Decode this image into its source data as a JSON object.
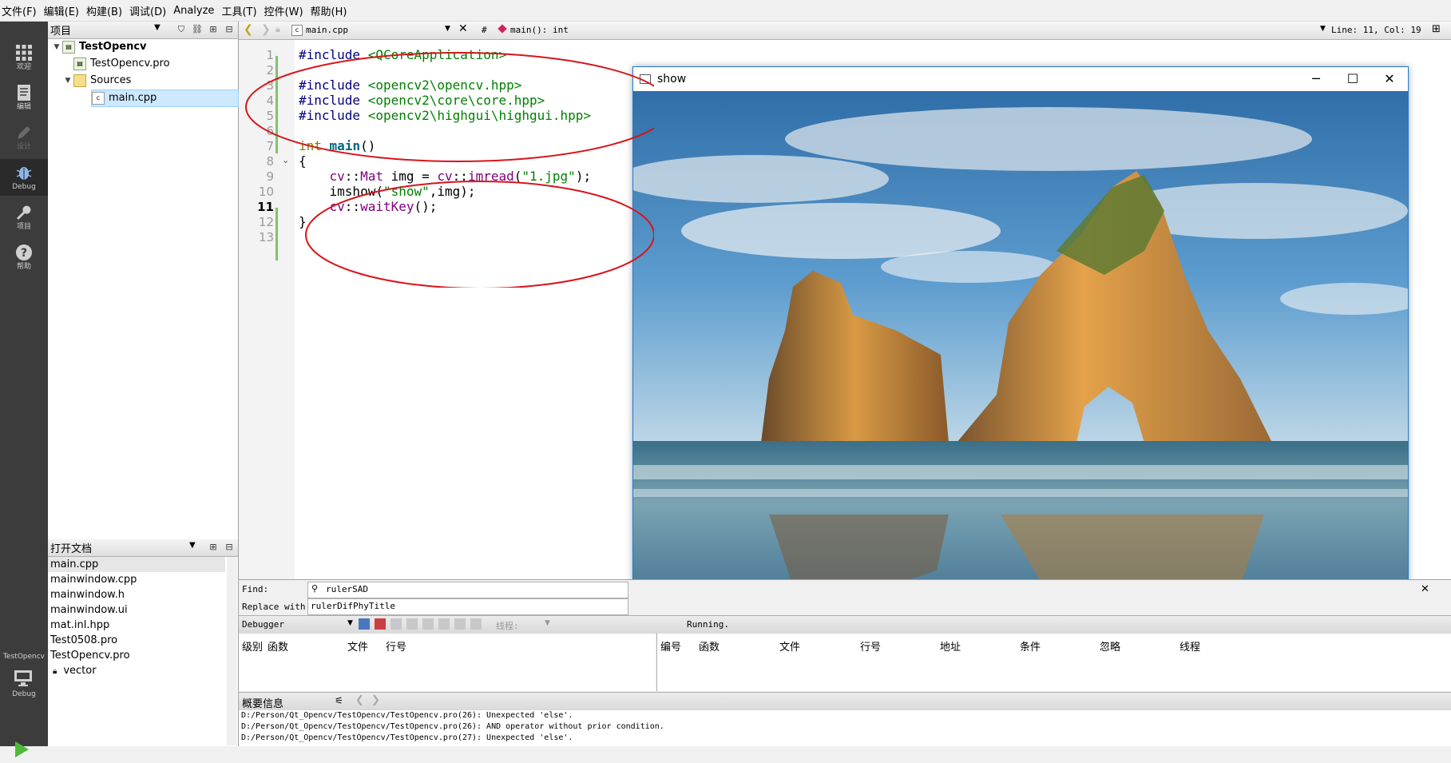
{
  "menu": [
    "文件(F)",
    "编辑(E)",
    "构建(B)",
    "调试(D)",
    "Analyze",
    "工具(T)",
    "控件(W)",
    "帮助(H)"
  ],
  "modes": [
    {
      "label": "欢迎",
      "icon": "grid-icon"
    },
    {
      "label": "编辑",
      "icon": "document-icon"
    },
    {
      "label": "设计",
      "icon": "pencil-icon"
    },
    {
      "label": "Debug",
      "icon": "bug-icon"
    },
    {
      "label": "项目",
      "icon": "wrench-icon"
    },
    {
      "label": "帮助",
      "icon": "help-icon"
    }
  ],
  "kit": {
    "project": "TestOpencv",
    "build": "Debug"
  },
  "project_pane": {
    "title": "项目",
    "tree": [
      {
        "label": "TestOpencv",
        "depth": 0,
        "expanded": true,
        "bold": true
      },
      {
        "label": "TestOpencv.pro",
        "depth": 1
      },
      {
        "label": "Sources",
        "depth": 1,
        "expanded": true
      },
      {
        "label": "main.cpp",
        "depth": 2,
        "selected": true
      }
    ]
  },
  "open_docs": {
    "title": "打开文档",
    "items": [
      "main.cpp",
      "mainwindow.cpp",
      "mainwindow.h",
      "mainwindow.ui",
      "mat.inl.hpp",
      "Test0508.pro",
      "TestOpencv.pro",
      "vector"
    ]
  },
  "editor": {
    "file": "main.cpp",
    "symbol": "main(): int",
    "position": "Line: 11, Col: 19",
    "current_line": 11,
    "lines": [
      "#include <QCoreApplication>",
      "",
      "#include <opencv2\\opencv.hpp>",
      "#include <opencv2\\core\\core.hpp>",
      "#include <opencv2\\highgui\\highgui.hpp>",
      "",
      "int main()",
      "{",
      "    cv::Mat img = cv::imread(\"1.jpg\");",
      "    imshow(\"show\",img);",
      "    cv::waitKey();",
      "}",
      ""
    ]
  },
  "show_window": {
    "title": "show"
  },
  "find": {
    "find_label": "Find:",
    "find_value": "rulerSAD",
    "replace_label": "Replace with:",
    "replace_value": "rulerDifPhyTitle"
  },
  "debugger": {
    "label": "Debugger",
    "thread_label": "线程:",
    "status": "Running."
  },
  "stack_columns": [
    "级别",
    "函数",
    "文件",
    "行号"
  ],
  "break_columns": [
    "编号",
    "函数",
    "文件",
    "行号",
    "地址",
    "条件",
    "忽略",
    "线程"
  ],
  "messages": {
    "title": "概要信息",
    "lines": [
      "D:/Person/Qt_Opencv/TestOpencv/TestOpencv.pro(26): Unexpected 'else'.",
      "D:/Person/Qt_Opencv/TestOpencv/TestOpencv.pro(26): AND operator without prior condition.",
      "D:/Person/Qt_Opencv/TestOpencv/TestOpencv.pro(27): Unexpected 'else'."
    ]
  }
}
